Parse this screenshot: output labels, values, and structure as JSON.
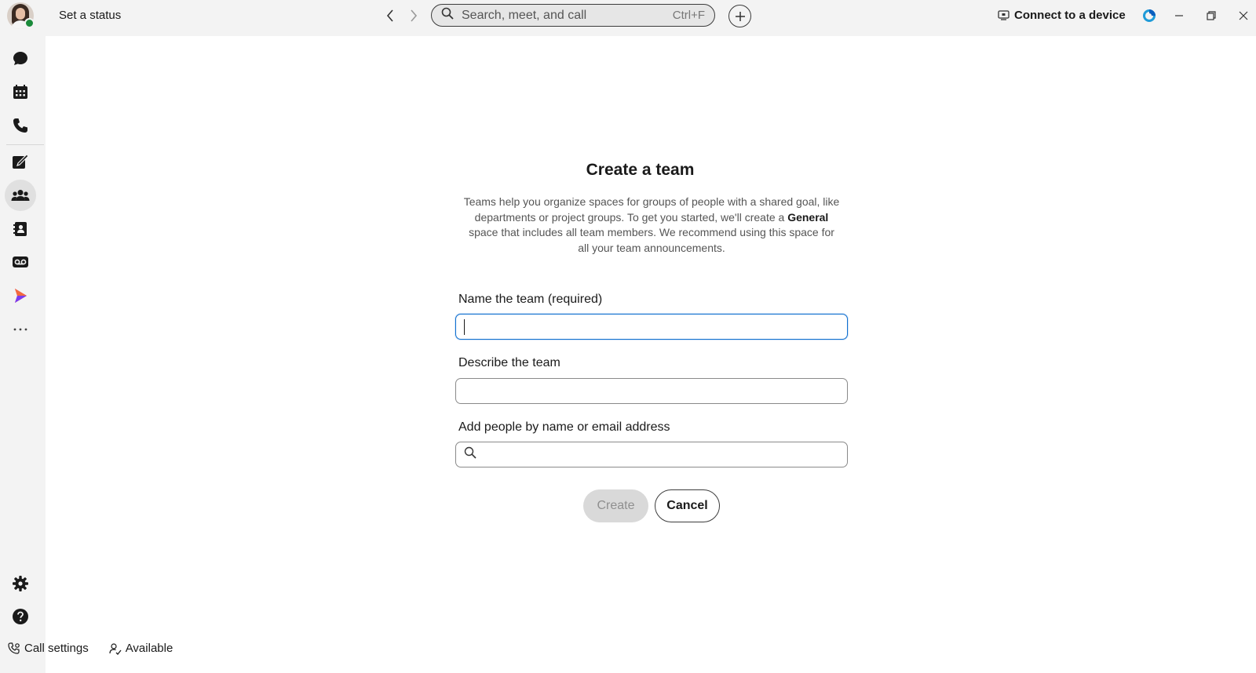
{
  "topbar": {
    "status_text": "Set a status",
    "search_placeholder": "Search, meet, and call",
    "search_shortcut": "Ctrl+F",
    "connect_label": "Connect to a device"
  },
  "sidebar": {
    "items": [
      {
        "name": "messaging-icon"
      },
      {
        "name": "calendar-icon"
      },
      {
        "name": "phone-icon"
      },
      {
        "name": "whiteboard-icon"
      },
      {
        "name": "teams-icon",
        "active": true
      },
      {
        "name": "contacts-icon"
      },
      {
        "name": "voicemail-icon"
      },
      {
        "name": "vidcast-icon"
      },
      {
        "name": "more-icon"
      }
    ],
    "settings_icon": "gear-icon",
    "help_icon": "help-icon"
  },
  "footer": {
    "call_settings_label": "Call settings",
    "availability_label": "Available"
  },
  "dialog": {
    "title": "Create a team",
    "description_part1": "Teams help you organize spaces for groups of people with a shared goal, like departments or project groups. To get you started, we'll create a",
    "description_bold": "General",
    "description_part2": "space that includes all team members. We recommend using this space for all your team announcements.",
    "name_label": "Name the team (required)",
    "name_value": "",
    "describe_label": "Describe the team",
    "describe_value": "",
    "people_label": "Add people by name or email address",
    "people_value": "",
    "create_label": "Create",
    "cancel_label": "Cancel"
  },
  "colors": {
    "accent": "#1170cf",
    "presence": "#1a8a3a",
    "vidcast": "#e4155b"
  }
}
